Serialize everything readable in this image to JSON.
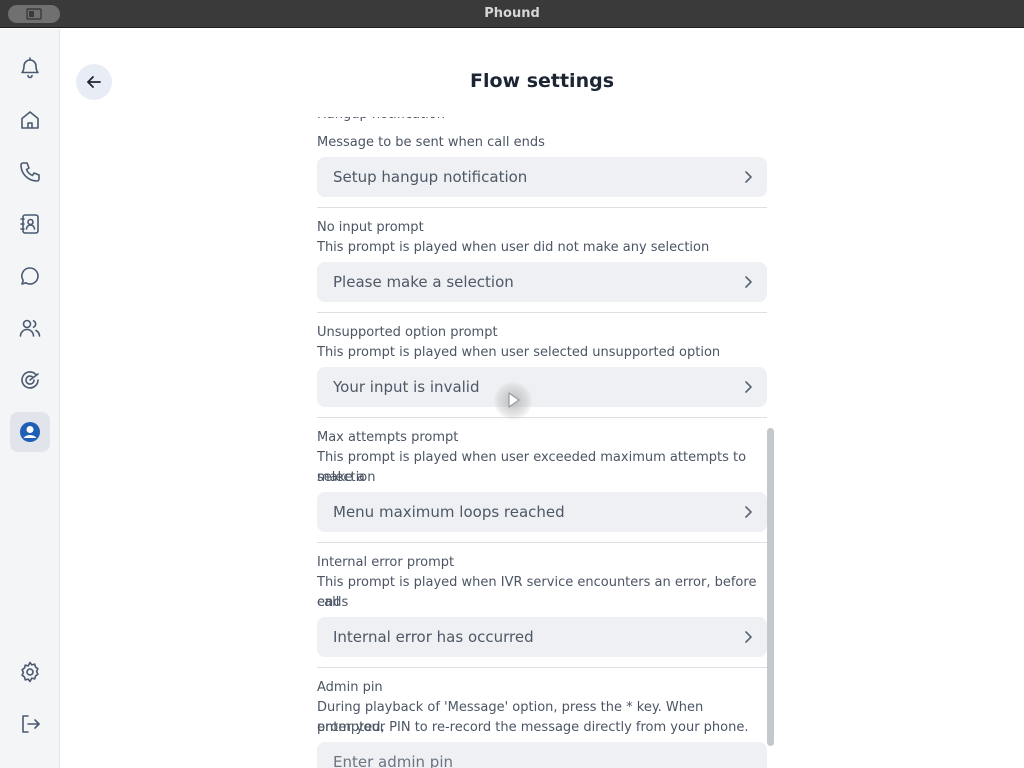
{
  "window": {
    "title": "Phound"
  },
  "sidebar": {
    "items": [
      {
        "icon": "bell-icon"
      },
      {
        "icon": "home-icon"
      },
      {
        "icon": "phone-icon"
      },
      {
        "icon": "contacts-icon"
      },
      {
        "icon": "chat-icon"
      },
      {
        "icon": "users-icon"
      },
      {
        "icon": "flow-icon"
      },
      {
        "icon": "account-icon",
        "active": true
      }
    ],
    "bottom": [
      {
        "icon": "gear-icon"
      },
      {
        "icon": "logout-icon"
      }
    ]
  },
  "header": {
    "title": "Flow settings"
  },
  "settings": {
    "hangup": {
      "description": "Message to be sent when call ends",
      "value": "Setup hangup notification"
    },
    "no_input": {
      "label": "No input prompt",
      "description": "This prompt is played when user did not make any selection",
      "value": "Please make a selection"
    },
    "unsupported": {
      "label": "Unsupported option prompt",
      "description": "This prompt is played when user selected unsupported option",
      "value": "Your input is invalid"
    },
    "max_attempts": {
      "label": "Max attempts prompt",
      "description_line1": "This prompt is played when user exceeded maximum attempts to make a",
      "description_line2": "selection",
      "value": "Menu maximum loops reached"
    },
    "internal_error": {
      "label": "Internal error prompt",
      "description_line1": "This prompt is played when IVR service encounters an error, before call",
      "description_line2": "ends",
      "value": "Internal error has occurred"
    },
    "admin_pin": {
      "label": "Admin pin",
      "description_line1": "During playback of 'Message' option, press the * key. When prompted,",
      "description_line2": "enter your PIN to re-record the message directly from your phone.",
      "placeholder": "Enter admin pin"
    }
  },
  "colors": {
    "accent": "#1f5fb5",
    "icon": "#4a5a70",
    "field_bg": "#eef0f3"
  }
}
